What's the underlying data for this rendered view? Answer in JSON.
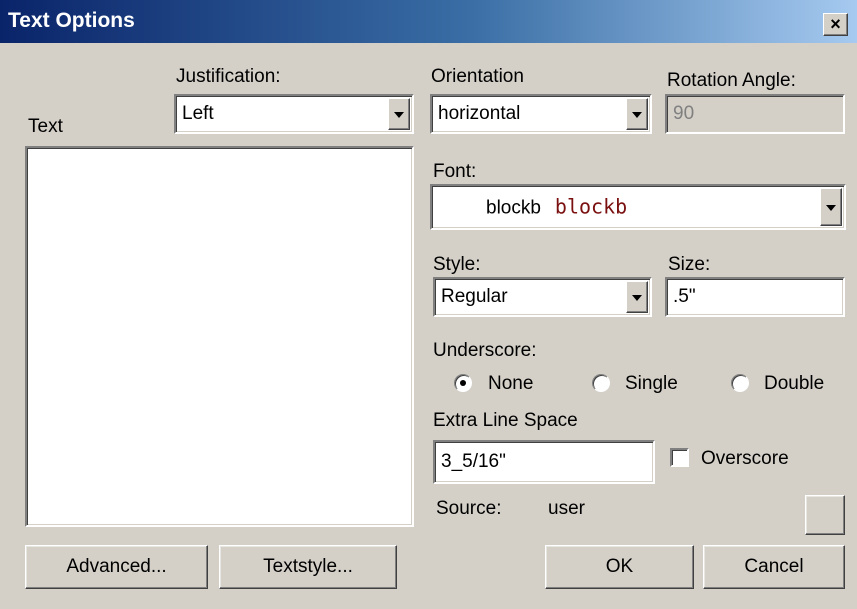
{
  "window": {
    "title": "Text Options",
    "close_glyph": "×"
  },
  "text_label": "Text",
  "text_area_value": "",
  "justification": {
    "label": "Justification:",
    "value": "Left"
  },
  "orientation": {
    "label": "Orientation",
    "value": "horizontal"
  },
  "rotation": {
    "label": "Rotation Angle:",
    "value": "90"
  },
  "font": {
    "label": "Font:",
    "name": "blockb",
    "preview": "blockb"
  },
  "style": {
    "label": "Style:",
    "value": "Regular"
  },
  "size": {
    "label": "Size:",
    "value": ".5\""
  },
  "underscore": {
    "label": "Underscore:",
    "options": [
      {
        "label": "None",
        "checked": true
      },
      {
        "label": "Single",
        "checked": false
      },
      {
        "label": "Double",
        "checked": false
      }
    ]
  },
  "extra_line_space": {
    "label": "Extra Line Space",
    "value": "3_5/16\""
  },
  "overscore": {
    "label": "Overscore",
    "checked": false
  },
  "source": {
    "label": "Source:",
    "value": "user"
  },
  "buttons": {
    "advanced": "Advanced...",
    "textstyle": "Textstyle...",
    "ok": "OK",
    "cancel": "Cancel"
  }
}
